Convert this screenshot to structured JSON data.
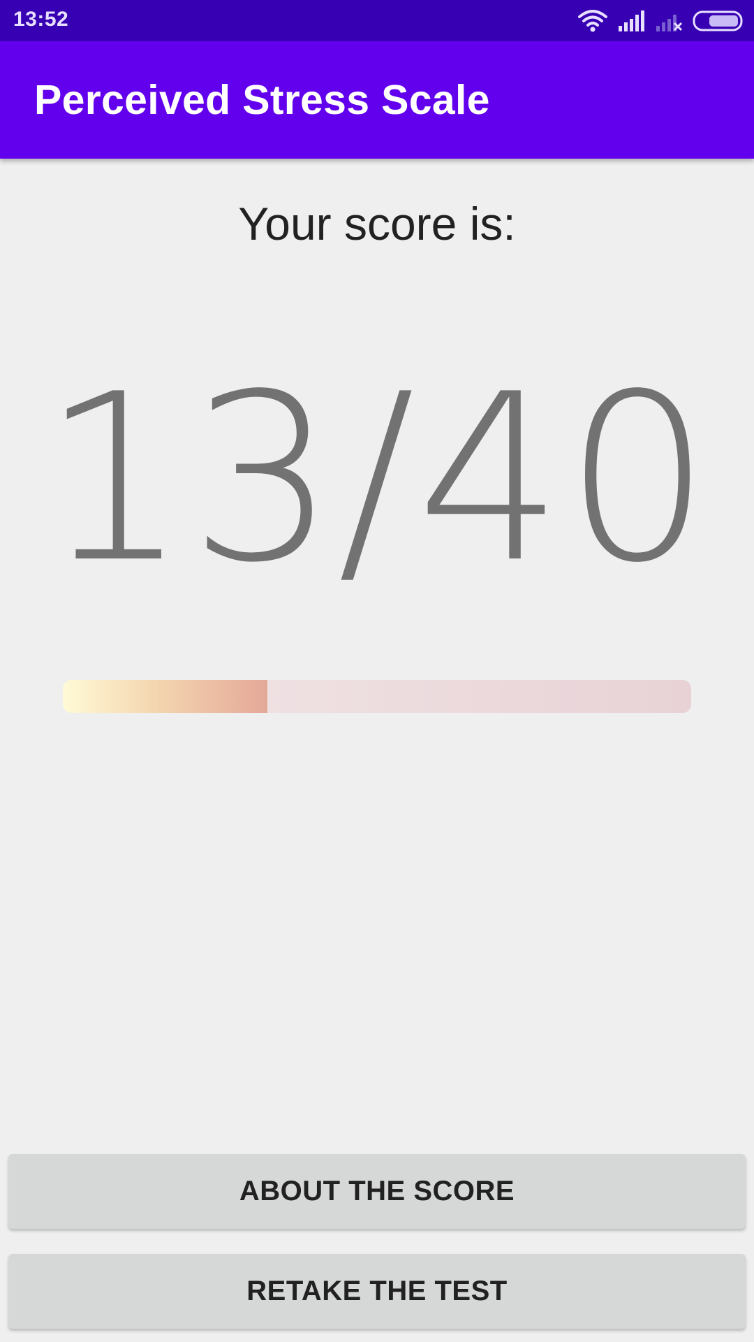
{
  "status_bar": {
    "time": "13:52",
    "icons": [
      "wifi-icon",
      "signal-icon",
      "signal-no-sim-icon",
      "battery-icon"
    ]
  },
  "app_bar": {
    "title": "Perceived Stress Scale"
  },
  "result": {
    "heading": "Your score is:",
    "score_text": "13/40",
    "score": 13,
    "max_score": 40
  },
  "buttons": {
    "about_label": "ABOUT THE SCORE",
    "retake_label": "RETAKE THE TEST"
  },
  "colors": {
    "status_bar": "#3700b3",
    "app_bar": "#6200ee",
    "background": "#efefef",
    "button": "#d6d7d7"
  }
}
